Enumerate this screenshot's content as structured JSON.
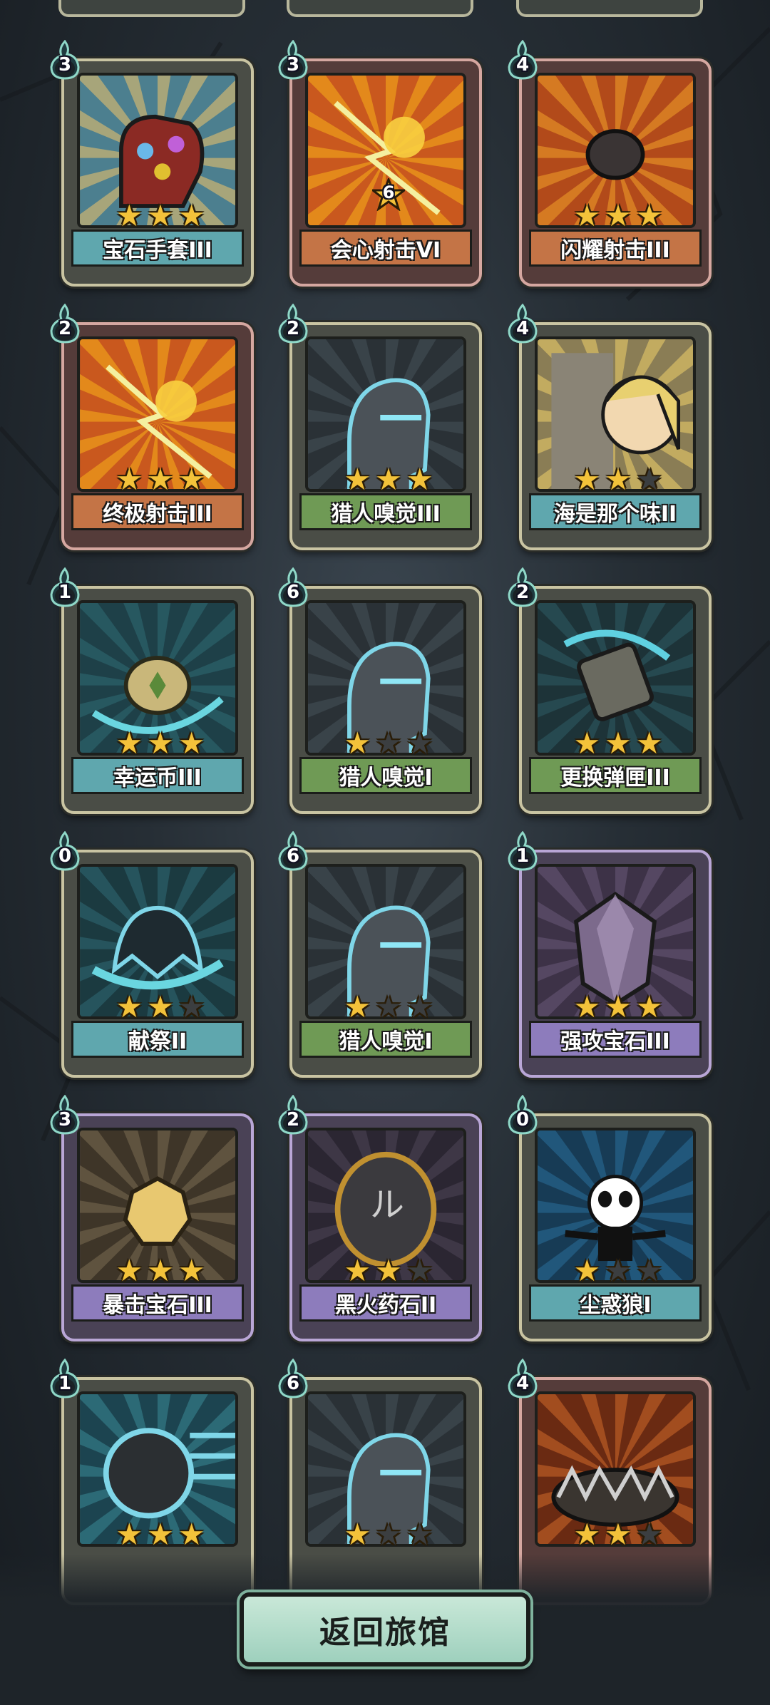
{
  "cards": [
    {
      "name": "宝石手套III",
      "cost": "3",
      "stars": 3,
      "color": "teal",
      "theme": "gauntlet"
    },
    {
      "name": "会心射击VI",
      "cost": "3",
      "stars": 0,
      "level": "6",
      "color": "orange",
      "theme": "lightning-gold",
      "frame": "red"
    },
    {
      "name": "闪耀射击III",
      "cost": "4",
      "stars": 3,
      "color": "orange",
      "theme": "rock",
      "frame": "red"
    },
    {
      "name": "终极射击III",
      "cost": "2",
      "stars": 3,
      "color": "orange",
      "theme": "lightning-gold",
      "frame": "red"
    },
    {
      "name": "猎人嗅觉III",
      "cost": "2",
      "stars": 3,
      "color": "green",
      "theme": "hunter"
    },
    {
      "name": "海是那个味II",
      "cost": "4",
      "stars": 2,
      "color": "teal",
      "theme": "face"
    },
    {
      "name": "幸运币III",
      "cost": "1",
      "stars": 3,
      "color": "teal",
      "theme": "coin"
    },
    {
      "name": "猎人嗅觉I",
      "cost": "6",
      "stars": 1,
      "color": "green",
      "theme": "hunter"
    },
    {
      "name": "更换弹匣III",
      "cost": "2",
      "stars": 3,
      "color": "green",
      "theme": "magazine"
    },
    {
      "name": "献祭II",
      "cost": "0",
      "stars": 2,
      "color": "teal",
      "theme": "ghost"
    },
    {
      "name": "猎人嗅觉I",
      "cost": "6",
      "stars": 1,
      "color": "green",
      "theme": "hunter"
    },
    {
      "name": "强攻宝石III",
      "cost": "1",
      "stars": 3,
      "color": "purple",
      "theme": "crystal",
      "frame": "purple"
    },
    {
      "name": "暴击宝石III",
      "cost": "3",
      "stars": 3,
      "color": "purple",
      "theme": "gem-sun",
      "frame": "purple"
    },
    {
      "name": "黑火药石II",
      "cost": "2",
      "stars": 2,
      "color": "purple",
      "theme": "rune-stone",
      "frame": "purple"
    },
    {
      "name": "尘惑狼I",
      "cost": "0",
      "stars": 1,
      "color": "teal",
      "theme": "panda"
    },
    {
      "name": "",
      "cost": "1",
      "stars": 3,
      "color": "teal",
      "theme": "ball"
    },
    {
      "name": "",
      "cost": "6",
      "stars": 1,
      "color": "green",
      "theme": "hunter"
    },
    {
      "name": "",
      "cost": "4",
      "stars": 2,
      "color": "orange",
      "theme": "trap",
      "frame": "red"
    }
  ],
  "return_button": "返回旅馆"
}
